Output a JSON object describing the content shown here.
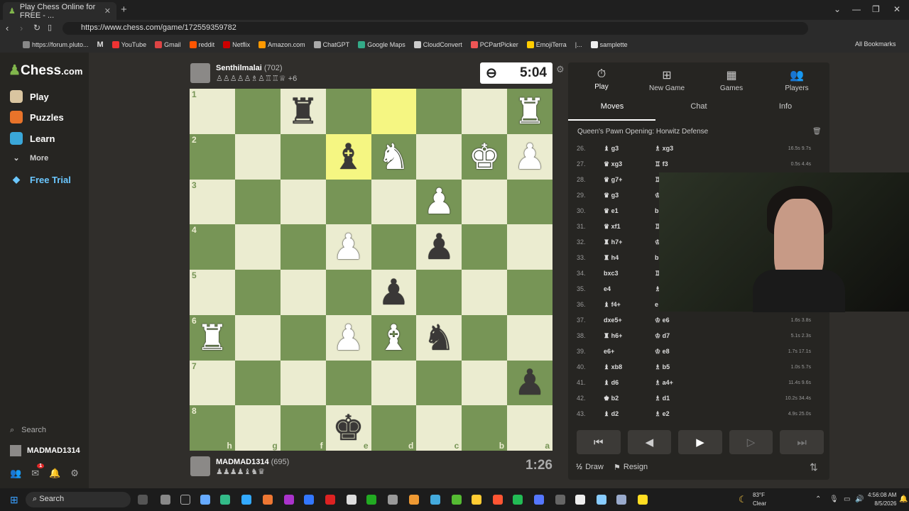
{
  "browser": {
    "tab_title": "Play Chess Online for FREE - ...",
    "url": "https://www.chess.com/game/172559359782",
    "bookmarks": [
      "https://forum.pluto...",
      "M",
      "YouTube",
      "Gmail",
      "reddit",
      "Netflix",
      "Amazon.com",
      "ChatGPT",
      "Google Maps",
      "CloudConvert",
      "PCPartPicker",
      "EmojiTerra",
      "|...",
      "samplette"
    ],
    "all_bookmarks": "All Bookmarks"
  },
  "sidebar": {
    "logo_prefix": "Chess",
    "logo_suffix": ".com",
    "items": [
      "Play",
      "Puzzles",
      "Learn",
      "More",
      "Free Trial"
    ],
    "search": "Search",
    "username": "MADMAD1314",
    "notif_count": "1"
  },
  "top_player": {
    "name": "Senthilmalai",
    "rating": "(702)",
    "captured": "♙♙♙♙♙♗♙♖♖♕ +6",
    "clock": "5:04"
  },
  "bottom_player": {
    "name": "MADMAD1314",
    "rating": "(695)",
    "captured": "♟♟♟♟♝♞♛",
    "clock": "1:26"
  },
  "board": {
    "ranks": [
      "1",
      "2",
      "3",
      "4",
      "5",
      "6",
      "7",
      "8"
    ],
    "files": [
      "h",
      "g",
      "f",
      "e",
      "d",
      "c",
      "b",
      "a"
    ],
    "rows": [
      [
        "",
        "",
        "bR",
        "",
        "",
        "",
        "",
        "wR"
      ],
      [
        "",
        "",
        "",
        "bB",
        "wN",
        "",
        "wK",
        "wP"
      ],
      [
        "",
        "",
        "",
        "",
        "",
        "wP",
        "",
        ""
      ],
      [
        "",
        "",
        "",
        "wP",
        "",
        "bP",
        "",
        ""
      ],
      [
        "",
        "",
        "",
        "",
        "bP",
        "",
        "",
        ""
      ],
      [
        "wR",
        "",
        "",
        "wP",
        "wB",
        "bN",
        "",
        ""
      ],
      [
        "",
        "",
        "",
        "",
        "",
        "",
        "",
        "bP"
      ],
      [
        "",
        "",
        "",
        "bK",
        "",
        "",
        "",
        ""
      ]
    ],
    "highlights": [
      [
        0,
        4
      ],
      [
        1,
        3
      ]
    ]
  },
  "panel": {
    "tabs": [
      "Play",
      "New Game",
      "Games",
      "Players"
    ],
    "subtabs": [
      "Moves",
      "Chat",
      "Info"
    ],
    "opening": "Queen's Pawn Opening: Horwitz Defense",
    "moves": [
      {
        "n": "26.",
        "w": "♝ g3",
        "b": "♗ xg3",
        "t": "16.5s 9.7s"
      },
      {
        "n": "27.",
        "w": "♛ xg3",
        "b": "♖ f3",
        "t": "0.5s 4.4s"
      },
      {
        "n": "28.",
        "w": "♛ g7+",
        "b": "♖",
        "t": ""
      },
      {
        "n": "29.",
        "w": "♛ g3",
        "b": "♔",
        "t": ""
      },
      {
        "n": "30.",
        "w": "♛ e1",
        "b": "b",
        "t": ""
      },
      {
        "n": "31.",
        "w": "♛ xf1",
        "b": "♖",
        "t": ""
      },
      {
        "n": "32.",
        "w": "♜ h7+",
        "b": "♔",
        "t": ""
      },
      {
        "n": "33.",
        "w": "♜ h4",
        "b": "b",
        "t": ""
      },
      {
        "n": "34.",
        "w": "bxc3",
        "b": "♖",
        "t": ""
      },
      {
        "n": "35.",
        "w": "e4",
        "b": "♗",
        "t": ""
      },
      {
        "n": "36.",
        "w": "♝ f4+",
        "b": "e",
        "t": ""
      },
      {
        "n": "37.",
        "w": "dxe5+",
        "b": "♔ e6",
        "t": "1.6s 3.8s"
      },
      {
        "n": "38.",
        "w": "♜ h6+",
        "b": "♔ d7",
        "t": "5.1s 2.3s"
      },
      {
        "n": "39.",
        "w": "e6+",
        "b": "♔ e8",
        "t": "1.7s 17.1s"
      },
      {
        "n": "40.",
        "w": "♝ xb8",
        "b": "♗ b5",
        "t": "1.0s 5.7s"
      },
      {
        "n": "41.",
        "w": "♝ d6",
        "b": "♗ a4+",
        "t": "11.4s 9.6s"
      },
      {
        "n": "42.",
        "w": "♚ b2",
        "b": "♗ d1",
        "t": "10.2s 34.4s"
      },
      {
        "n": "43.",
        "w": "♝ d2",
        "b": "♗ e2",
        "t": "4.9s 25.0s"
      }
    ],
    "draw": "Draw",
    "resign": "Resign"
  },
  "taskbar": {
    "search": "Search",
    "weather_temp": "83°F",
    "weather_desc": "Clear",
    "time": "4:56:08 AM",
    "date": "8/5/2026"
  }
}
